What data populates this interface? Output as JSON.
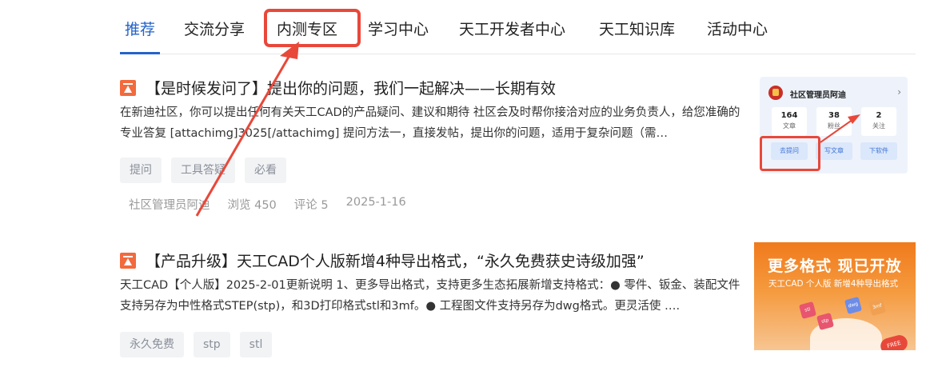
{
  "tabs": [
    {
      "label": "推荐"
    },
    {
      "label": "交流分享"
    },
    {
      "label": "内测专区"
    },
    {
      "label": "学习中心"
    },
    {
      "label": "天工开发者中心"
    },
    {
      "label": "天工知识库"
    },
    {
      "label": "活动中心"
    }
  ],
  "active_tab": "推荐",
  "posts": [
    {
      "title": "【是时候发问了】提出你的问题，我们一起解决——长期有效",
      "excerpt": "在新迪社区，你可以提出任何有关天工CAD的产品疑问、建议和期待 社区会及时帮你接洽对应的业务负责人，给您准确的专业答复 [attachimg]3025[/attachimg] 提问方法一，直接发帖，提出你的问题，适用于复杂问题（需…",
      "tags": [
        "提问",
        "工具答疑",
        "必看"
      ],
      "author": "社区管理员阿迪",
      "views": "浏览 450",
      "comments": "评论 5",
      "date": "2025-1-16",
      "thumbnail": {
        "name": "社区管理员阿迪",
        "stats": [
          {
            "value": "164",
            "label": "文章"
          },
          {
            "value": "38",
            "label": "粉丝"
          },
          {
            "value": "2",
            "label": "关注"
          }
        ],
        "buttons": [
          "去提问",
          "写文章",
          "下软件"
        ]
      }
    },
    {
      "title": "【产品升级】天工CAD个人版新增4种导出格式，“永久免费获史诗级加强”",
      "excerpt": "天工CAD【个人版】2025-2-01更新说明 1、更多导出格式，支持更多生态拓展新增支持格式：● 零件、钣金、装配文件支持另存为中性格式STEP(stp)，和3D打印格式stl和3mf。● 工程图文件支持另存为dwg格式。更灵活使 ….",
      "tags": [
        "永久免费",
        "stp",
        "stl"
      ],
      "thumbnail": {
        "title": "更多格式 现已开放",
        "subtitle": "天工CAD 个人版 新增4种导出格式",
        "badges": [
          "stl",
          "dwg",
          "stp",
          "3mf"
        ],
        "free_label": "FREE"
      }
    }
  ],
  "colors": {
    "accent": "#2563c9",
    "annotation": "#e8483a",
    "pin": "#f26a3d",
    "tag_bg": "#f2f3f5"
  }
}
